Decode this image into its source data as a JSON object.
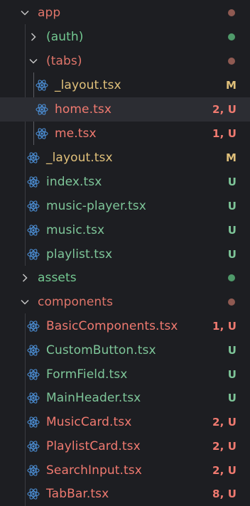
{
  "colors": {
    "modified": "#e0c07a",
    "untracked": "#7ec699",
    "error": "#f07a70",
    "folder_dot_red": "#8f5a52",
    "folder_dot_green": "#4f9a6a",
    "react_icon": "#4c8fd6",
    "chevron": "#c5c5c5",
    "folder_text": "#e0756a",
    "folder_text_green": "#73c991"
  },
  "tree": {
    "app": {
      "label": "app"
    },
    "auth": {
      "label": "(auth)"
    },
    "tabs": {
      "label": "(tabs)"
    },
    "tabs_layout": {
      "label": "_layout.tsx",
      "status": "M"
    },
    "home": {
      "label": "home.tsx",
      "status": "2, U"
    },
    "me": {
      "label": "me.tsx",
      "status": "1, U"
    },
    "app_layout": {
      "label": "_layout.tsx",
      "status": "M"
    },
    "index": {
      "label": "index.tsx",
      "status": "U"
    },
    "music_player": {
      "label": "music-player.tsx",
      "status": "U"
    },
    "music": {
      "label": "music.tsx",
      "status": "U"
    },
    "playlist": {
      "label": "playlist.tsx",
      "status": "U"
    },
    "assets": {
      "label": "assets"
    },
    "components": {
      "label": "components"
    },
    "basic_components": {
      "label": "BasicComponents.tsx",
      "status": "1, U"
    },
    "custom_button": {
      "label": "CustomButton.tsx",
      "status": "U"
    },
    "form_field": {
      "label": "FormField.tsx",
      "status": "U"
    },
    "main_header": {
      "label": "MainHeader.tsx",
      "status": "U"
    },
    "music_card": {
      "label": "MusicCard.tsx",
      "status": "2, U"
    },
    "playlist_card": {
      "label": "PlaylistCard.tsx",
      "status": "2, U"
    },
    "search_input": {
      "label": "SearchInput.tsx",
      "status": "2, U"
    },
    "tab_bar": {
      "label": "TabBar.tsx",
      "status": "8, U"
    }
  }
}
